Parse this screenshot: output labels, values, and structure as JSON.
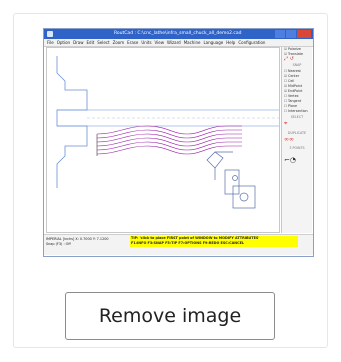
{
  "app": {
    "title": "RoutCad : C:\\cnc_lathe\\infra_small_chuck_all_demo2.cad",
    "menu": [
      "File",
      "Option",
      "Draw",
      "Edit",
      "Select",
      "Zoom",
      "Erase",
      "Units",
      "View",
      "Wizard",
      "Machine",
      "Language",
      "Help",
      "Configuration"
    ],
    "panel": {
      "top_checks": [
        "Polarize",
        "Translate"
      ],
      "snap_header": "SNAP",
      "snap_items": [
        "Nearest",
        "Center",
        "Cell",
        "MidPoint",
        "EndPoint",
        "Vertex",
        "Tangent",
        "Plane",
        "Intersection"
      ],
      "select_header": "SELECT",
      "duplicate_header": "DUPLICATE",
      "points_header": "3 POINTS"
    },
    "status": {
      "left_line1": "IMPERIAL [inchs] X: 0.7000 Y: 7.1200",
      "left_line2": "Snap (F3) : Off",
      "tip_line1": "TIP: 'click to place FIRST point of WINDOW to MODIFY ATTRIBUTES'",
      "tip_line2": "F1:INFO F3:SNAP F5:TIP F7:OPTIONS F9:REDO ESC:CANCEL"
    },
    "colors": {
      "titlebar": "#2f63c8",
      "tip": "#ffff00",
      "profile": "#9b1ea8",
      "guides": "#6a8fd8"
    }
  },
  "remove_button": {
    "label": "Remove image"
  }
}
